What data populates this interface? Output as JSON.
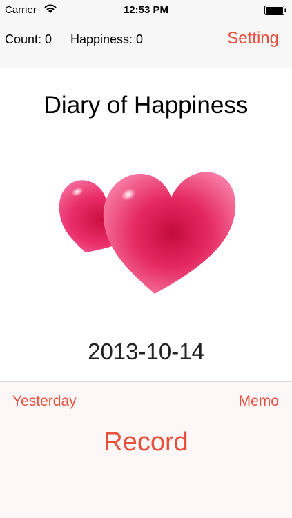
{
  "status_bar": {
    "carrier": "Carrier",
    "time": "12:53 PM"
  },
  "top_bar": {
    "count_label": "Count: 0",
    "happiness_label": "Happiness: 0",
    "setting_label": "Setting"
  },
  "main": {
    "title": "Diary of Happiness",
    "image_icon": "two-hearts-icon",
    "date": "2013-10-14"
  },
  "bottom": {
    "yesterday_label": "Yesterday",
    "memo_label": "Memo",
    "record_label": "Record"
  },
  "colors": {
    "accent": "#e8503e",
    "heart": "#e8306a"
  }
}
